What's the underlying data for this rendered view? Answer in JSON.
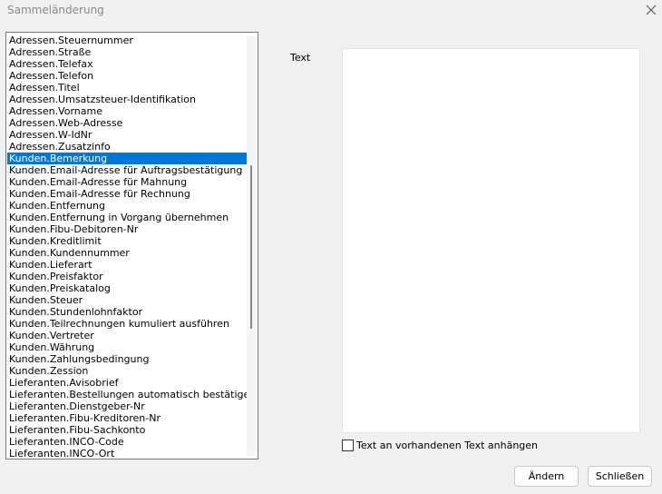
{
  "window": {
    "title": "Sammeländerung",
    "close_icon": "close-icon"
  },
  "list": {
    "selected_index": 10,
    "items": [
      "Adressen.Steuernummer",
      "Adressen.Straße",
      "Adressen.Telefax",
      "Adressen.Telefon",
      "Adressen.Titel",
      "Adressen.Umsatzsteuer-Identifikation",
      "Adressen.Vorname",
      "Adressen.Web-Adresse",
      "Adressen.W-IdNr",
      "Adressen.Zusatzinfo",
      "Kunden.Bemerkung",
      "Kunden.Email-Adresse für Auftragsbestätigung",
      "Kunden.Email-Adresse für Mahnung",
      "Kunden.Email-Adresse für Rechnung",
      "Kunden.Entfernung",
      "Kunden.Entfernung in Vorgang übernehmen",
      "Kunden.Fibu-Debitoren-Nr",
      "Kunden.Kreditlimit",
      "Kunden.Kundennummer",
      "Kunden.Lieferart",
      "Kunden.Preisfaktor",
      "Kunden.Preiskatalog",
      "Kunden.Steuer",
      "Kunden.Stundenlohnfaktor",
      "Kunden.Teilrechnungen kumuliert ausführen",
      "Kunden.Vertreter",
      "Kunden.Währung",
      "Kunden.Zahlungsbedingung",
      "Kunden.Zession",
      "Lieferanten.Avisobrief",
      "Lieferanten.Bestellungen automatisch bestätigen",
      "Lieferanten.Dienstgeber-Nr",
      "Lieferanten.Fibu-Kreditoren-Nr",
      "Lieferanten.Fibu-Sachkonto",
      "Lieferanten.INCO-Code",
      "Lieferanten.INCO-Ort"
    ]
  },
  "text_field": {
    "label": "Text",
    "value": ""
  },
  "append_checkbox": {
    "label": "Text an vorhandenen Text anhängen",
    "checked": false
  },
  "buttons": {
    "change": "Ändern",
    "close": "Schließen"
  },
  "colors": {
    "selection": "#0078d7",
    "background": "#f0f0f0"
  }
}
